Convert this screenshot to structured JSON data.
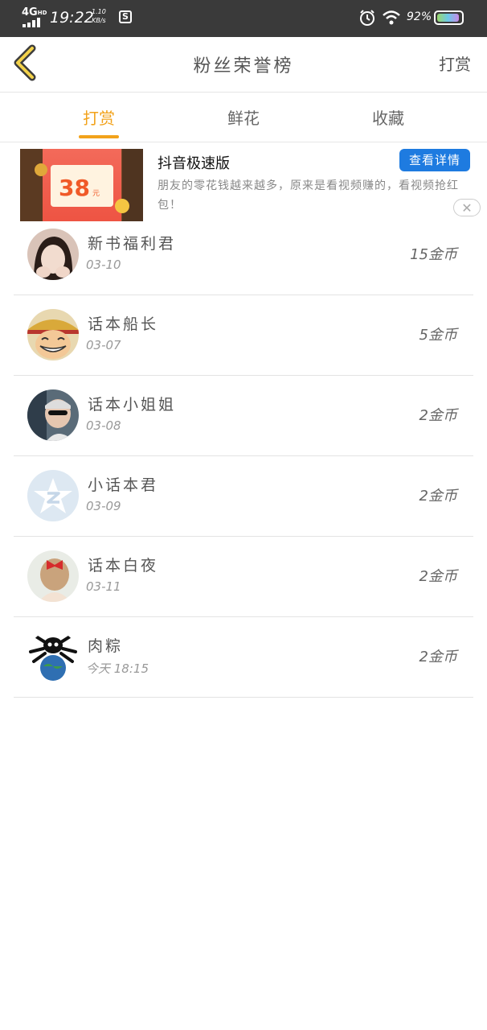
{
  "status_bar": {
    "network": "4G",
    "network_sup": "HD",
    "time": "19:22",
    "speed_value": "1.10",
    "speed_unit": "KB/s",
    "app_badge": "S",
    "battery_text": "92%",
    "battery_level": 0.92
  },
  "nav": {
    "title": "粉丝荣誉榜",
    "action_label": "打赏"
  },
  "tabs": [
    {
      "label": "打赏",
      "active": true
    },
    {
      "label": "鲜花",
      "active": false
    },
    {
      "label": "收藏",
      "active": false
    }
  ],
  "ad": {
    "title": "抖音极速版",
    "description": "朋友的零花钱越来越多，原来是看视频赚的，看视频抢红包！",
    "button_label": "查看详情",
    "image_amount": "38",
    "image_unit": "元",
    "close_icon": "✕"
  },
  "fans": [
    {
      "name": "新书福利君",
      "date": "03-10",
      "coins": "15金币",
      "avatar_icon": "photo-avatar-girl"
    },
    {
      "name": "话本船长",
      "date": "03-07",
      "coins": "5金币",
      "avatar_icon": "cartoon-avatar-luffy"
    },
    {
      "name": "话本小姐姐",
      "date": "03-08",
      "coins": "2金币",
      "avatar_icon": "photo-avatar-sunglasses"
    },
    {
      "name": "小话本君",
      "date": "03-09",
      "coins": "2金币",
      "avatar_icon": "default-qq-avatar"
    },
    {
      "name": "话本白夜",
      "date": "03-11",
      "coins": "2金币",
      "avatar_icon": "photo-avatar-redbow"
    },
    {
      "name": "肉粽",
      "date": "今天 18:15",
      "coins": "2金币",
      "avatar_icon": "cartoon-avatar-globe"
    }
  ],
  "colors": {
    "accent": "#f2a21a",
    "ad_button": "#1e7be0",
    "status_bar": "#3a3a3a"
  }
}
